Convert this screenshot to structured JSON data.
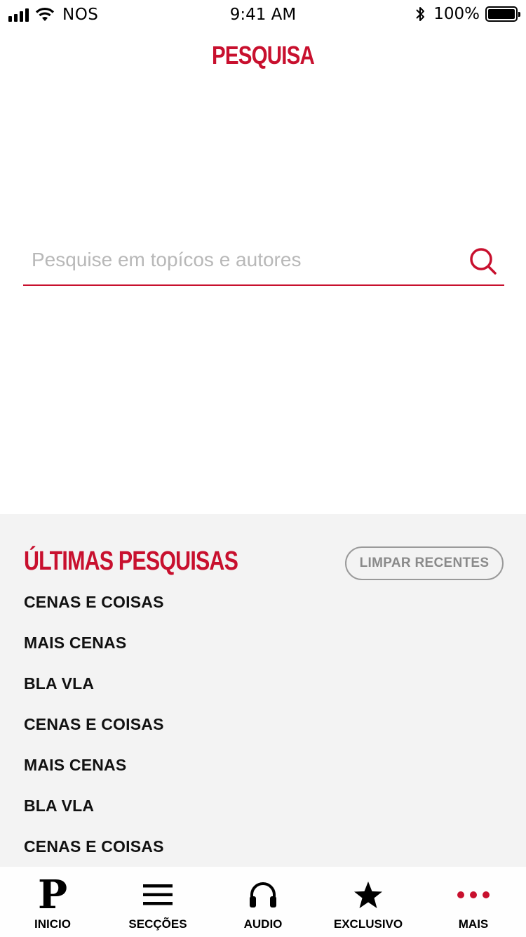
{
  "status_bar": {
    "carrier": "NOS",
    "time": "9:41 AM",
    "battery": "100%"
  },
  "header": {
    "title": "PESQUISA"
  },
  "search": {
    "placeholder": "Pesquise em topícos e autores",
    "value": ""
  },
  "recent": {
    "title": "ÚLTIMAS PESQUISAS",
    "clear_label": "LIMPAR RECENTES",
    "items": [
      "CENAS E COISAS",
      "MAIS CENAS",
      "BLA VLA",
      "CENAS E COISAS",
      "MAIS CENAS",
      "BLA VLA",
      "CENAS E COISAS"
    ]
  },
  "tab_bar": {
    "tabs": [
      {
        "label": "INICIO",
        "icon": "publico-logo-icon"
      },
      {
        "label": "SECÇÕES",
        "icon": "menu-icon"
      },
      {
        "label": "AUDIO",
        "icon": "headphones-icon"
      },
      {
        "label": "EXCLUSIVO",
        "icon": "star-icon"
      },
      {
        "label": "MAIS",
        "icon": "more-dots-icon"
      }
    ]
  },
  "colors": {
    "accent": "#c8102e",
    "panel_bg": "#f3f3f3"
  }
}
